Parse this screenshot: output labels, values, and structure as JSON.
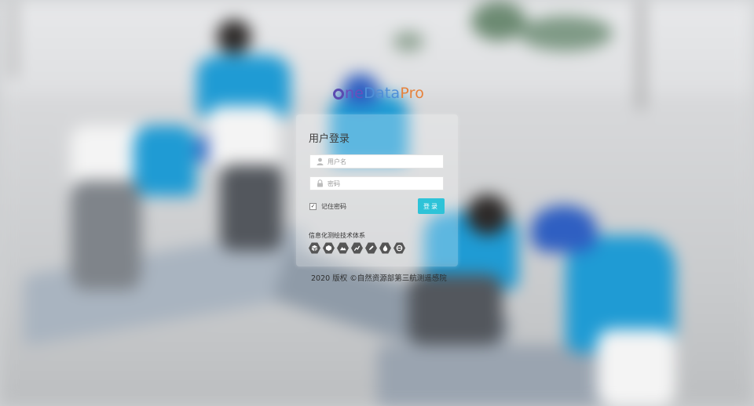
{
  "brand": {
    "logo_parts": [
      "ne",
      "Data",
      "Pro"
    ],
    "colors": {
      "mark": "#5b4bb1",
      "part1": "#6a4fbc",
      "part2": "#4f8fd8",
      "part3": "#e6823c"
    }
  },
  "login": {
    "title": "用户登录",
    "username_placeholder": "用户名",
    "password_placeholder": "密码",
    "remember_label": "记住密码",
    "remember_checked": true,
    "submit_label": "登录",
    "accent": "#2ec3d8"
  },
  "systems": {
    "label": "信息化测绘技术体系",
    "icons": [
      "cube-icon",
      "hexagon-icon",
      "mountain-icon",
      "chart-icon",
      "pen-icon",
      "drop-icon",
      "globe-icon"
    ]
  },
  "footer": {
    "copyright": "2020 版权 ©自然资源部第三航测遥感院"
  }
}
